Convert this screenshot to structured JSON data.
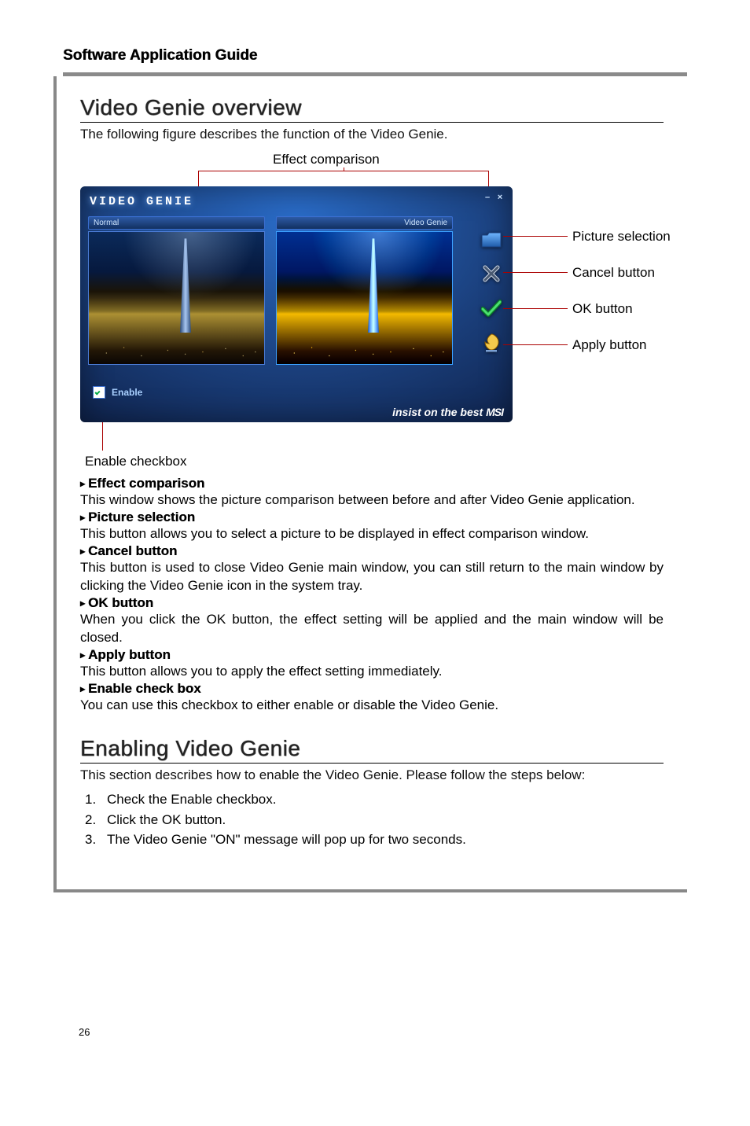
{
  "header": "Software Application Guide",
  "section1": {
    "title": "Video Genie overview",
    "intro": "The following figure describes the function of the Video Genie."
  },
  "figure": {
    "top_label": "Effect comparison",
    "app_title": "VIDEO  GENIE",
    "normal_label": "Normal",
    "vg_label": "Video Genie",
    "enable_label": "Enable",
    "slogan_prefix": "insist on the best ",
    "slogan_brand": "MSI",
    "callouts": {
      "picture": "Picture selection",
      "cancel": "Cancel button",
      "ok": "OK button",
      "apply": "Apply button",
      "enable": "Enable checkbox"
    }
  },
  "descriptions": [
    {
      "title": "Effect comparison",
      "body": "This window shows the picture comparison between before and after Video Genie application."
    },
    {
      "title": "Picture selection",
      "body": "This button allows you to select a picture to be displayed in effect comparison window."
    },
    {
      "title": "Cancel button",
      "body": "This button is used to close Video Genie main window, you can still return to the main window by clicking the Video Genie icon in the system tray."
    },
    {
      "title": "OK button",
      "body": "When you click the OK button, the effect setting will be applied and the main window will be closed."
    },
    {
      "title": "Apply button",
      "body": "This button allows you to apply the effect setting immediately."
    },
    {
      "title": "Enable check box",
      "body": "You can use this checkbox to either enable or disable the Video Genie."
    }
  ],
  "section2": {
    "title": "Enabling Video Genie",
    "intro": "This section describes how to enable the Video Genie. Please follow the steps below:",
    "steps": [
      "Check the Enable checkbox.",
      "Click the OK button.",
      "The Video Genie \"ON\" message will pop up for two seconds."
    ]
  },
  "page_number": "26"
}
